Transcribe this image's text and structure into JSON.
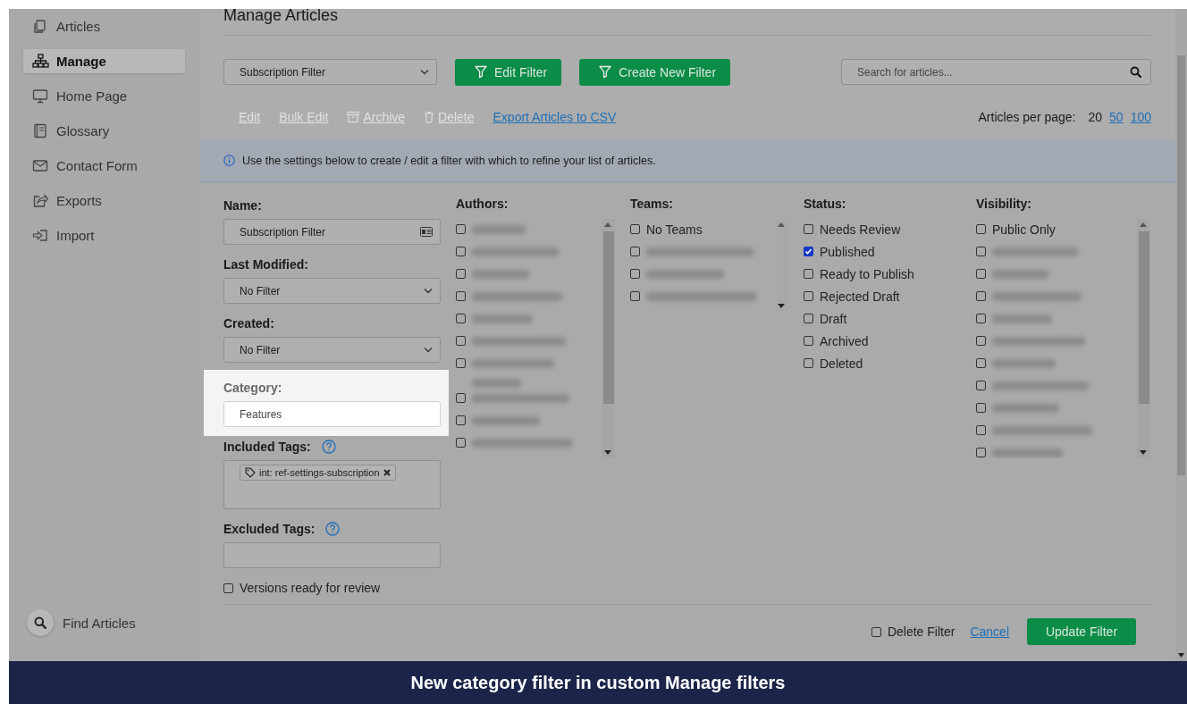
{
  "sidebar": {
    "items": [
      {
        "label": "Articles",
        "selected": false
      },
      {
        "label": "Manage",
        "selected": true
      },
      {
        "label": "Home Page",
        "selected": false
      },
      {
        "label": "Glossary",
        "selected": false
      },
      {
        "label": "Contact Form",
        "selected": false
      },
      {
        "label": "Exports",
        "selected": false
      },
      {
        "label": "Import",
        "selected": false
      }
    ],
    "find_articles": "Find Articles"
  },
  "header": {
    "title": "Manage Articles",
    "filter_select": "Subscription Filter",
    "buttons": [
      "Edit Filter",
      "Create New Filter"
    ],
    "search": {
      "placeholder": "Search for articles..."
    }
  },
  "actions": [
    {
      "label": "Edit",
      "kind": "plain",
      "disabled": true
    },
    {
      "label": "Bulk Edit",
      "kind": "plain",
      "disabled": true
    },
    {
      "label": "Archive",
      "kind": "archive",
      "disabled": true
    },
    {
      "label": "Delete",
      "kind": "delete",
      "disabled": true
    },
    {
      "label": "Export Articles to CSV",
      "kind": "plain",
      "disabled": false
    }
  ],
  "per_page": {
    "label": "Articles per page:",
    "options": [
      {
        "label": "20",
        "selected": true
      },
      {
        "label": "50",
        "selected": false
      },
      {
        "label": "100",
        "selected": false
      }
    ]
  },
  "info": "Use the settings below to create / edit a filter with which to refine your list of articles.",
  "form": {
    "name": {
      "label": "Name:",
      "value": "Subscription Filter"
    },
    "last_modified": {
      "label": "Last Modified:",
      "value": "No Filter"
    },
    "created": {
      "label": "Created:",
      "value": "No Filter"
    },
    "category": {
      "label": "Category:",
      "value": "Features",
      "highlighted": true
    },
    "included_tags": {
      "label": "Included Tags:",
      "tags": [
        "int: ref-settings-subscription"
      ]
    },
    "excluded_tags": {
      "label": "Excluded Tags:"
    },
    "versions": {
      "label": "Versions ready for review",
      "checked": false
    }
  },
  "lists": [
    {
      "title": "Authors:",
      "items": [
        {
          "kind": "blurred",
          "checked": false
        },
        {
          "kind": "blurred",
          "checked": false
        },
        {
          "kind": "blurred",
          "checked": false
        },
        {
          "kind": "blurred",
          "checked": false
        },
        {
          "kind": "blurred",
          "checked": false
        },
        {
          "kind": "blurred",
          "checked": false
        },
        {
          "kind": "blurred_wrapped",
          "checked": false
        },
        {
          "kind": "blurred",
          "checked": false
        },
        {
          "kind": "blurred",
          "checked": false
        },
        {
          "kind": "blurred",
          "checked": false
        }
      ]
    },
    {
      "title": "Teams:",
      "items": [
        {
          "kind": "text",
          "label": "No Teams",
          "checked": false
        },
        {
          "kind": "blurred",
          "checked": false
        },
        {
          "kind": "blurred",
          "checked": false
        },
        {
          "kind": "blurred",
          "checked": false
        }
      ]
    },
    {
      "title": "Status:",
      "items": [
        {
          "kind": "text",
          "label": "Needs Review",
          "checked": false
        },
        {
          "kind": "text",
          "label": "Published",
          "checked": true
        },
        {
          "kind": "text",
          "label": "Ready to Publish",
          "checked": false
        },
        {
          "kind": "text",
          "label": "Rejected Draft",
          "checked": false
        },
        {
          "kind": "text",
          "label": "Draft",
          "checked": false
        },
        {
          "kind": "text",
          "label": "Archived",
          "checked": false
        },
        {
          "kind": "text",
          "label": "Deleted",
          "checked": false
        }
      ]
    },
    {
      "title": "Visibility:",
      "items": [
        {
          "kind": "text",
          "label": "Public Only",
          "checked": false
        },
        {
          "kind": "blurred",
          "checked": false
        },
        {
          "kind": "blurred",
          "checked": false
        },
        {
          "kind": "blurred",
          "checked": false
        },
        {
          "kind": "blurred",
          "checked": false
        },
        {
          "kind": "blurred",
          "checked": false
        },
        {
          "kind": "blurred",
          "checked": false
        },
        {
          "kind": "blurred",
          "checked": false
        },
        {
          "kind": "blurred",
          "checked": false
        },
        {
          "kind": "blurred",
          "checked": false
        },
        {
          "kind": "blurred",
          "checked": false
        }
      ]
    }
  ],
  "footer": {
    "delete": {
      "label": "Delete Filter",
      "checked": false
    },
    "cancel": "Cancel",
    "update": "Update Filter"
  },
  "caption": "New category filter in custom Manage filters"
}
